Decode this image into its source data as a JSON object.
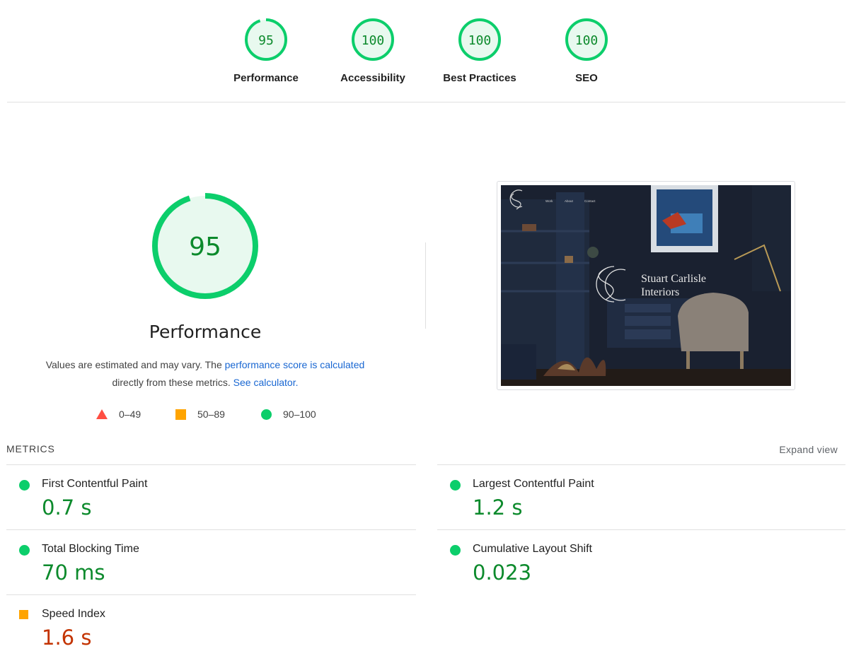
{
  "scores": [
    {
      "label": "Performance",
      "score": 95
    },
    {
      "label": "Accessibility",
      "score": 100
    },
    {
      "label": "Best Practices",
      "score": 100
    },
    {
      "label": "SEO",
      "score": 100
    }
  ],
  "performance": {
    "score": 95,
    "title": "Performance",
    "desc_text_1": "Values are estimated and may vary. The ",
    "desc_link_1": "performance score is calculated",
    "desc_text_2": "directly from these metrics.",
    "desc_link_2": "See calculator."
  },
  "legend": [
    {
      "range": "0–49",
      "icon": "triangle-red-icon"
    },
    {
      "range": "50–89",
      "icon": "square-orange-icon"
    },
    {
      "range": "90–100",
      "icon": "circle-green-icon"
    }
  ],
  "screenshot": {
    "nav": [
      "Work",
      "About",
      "Contact"
    ],
    "brand_line_1": "Stuart Carlisle",
    "brand_line_2": "Interiors"
  },
  "metrics": {
    "header": "METRICS",
    "expand": "Expand view",
    "items": [
      {
        "label": "First Contentful Paint",
        "value": "0.7 s",
        "rating": "pass"
      },
      {
        "label": "Largest Contentful Paint",
        "value": "1.2 s",
        "rating": "pass"
      },
      {
        "label": "Total Blocking Time",
        "value": "70 ms",
        "rating": "pass"
      },
      {
        "label": "Cumulative Layout Shift",
        "value": "0.023",
        "rating": "pass"
      },
      {
        "label": "Speed Index",
        "value": "1.6 s",
        "rating": "average"
      }
    ]
  },
  "colors": {
    "pass": "#0cce6b",
    "pass_text": "#0c8a2c",
    "average": "#ffa400",
    "average_text": "#c33300",
    "fail": "#ff4e42",
    "link": "#1967d2"
  }
}
